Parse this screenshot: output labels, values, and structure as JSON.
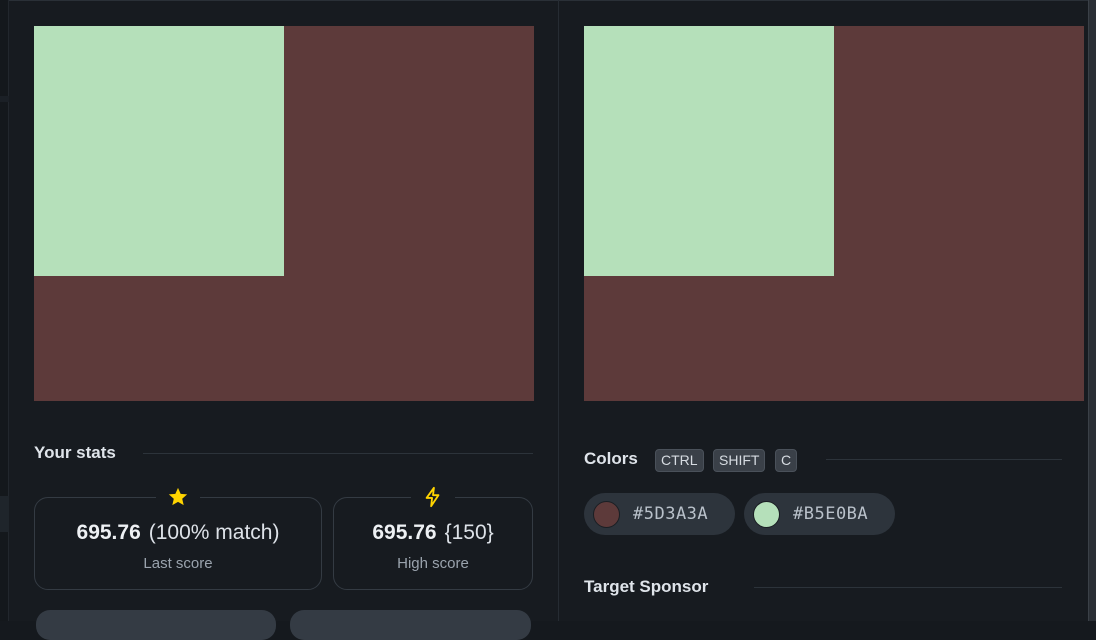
{
  "colors": {
    "dark": "#5D3A3A",
    "light": "#B5E0BA",
    "star": "#ffd400",
    "bolt": "#ffd400"
  },
  "stats": {
    "title": "Your stats",
    "last": {
      "value": "695.76",
      "extra": "(100% match)",
      "caption": "Last score",
      "icon": "star-icon"
    },
    "high": {
      "value": "695.76",
      "extra": "{150}",
      "caption": "High score",
      "icon": "lightning-icon"
    }
  },
  "palette": {
    "title": "Colors",
    "shortcut": [
      "CTRL",
      "SHIFT",
      "C"
    ],
    "chips": [
      {
        "hex": "#5D3A3A",
        "color": "#5D3A3A"
      },
      {
        "hex": "#B5E0BA",
        "color": "#B5E0BA"
      }
    ]
  },
  "sponsor": {
    "title": "Target Sponsor"
  }
}
